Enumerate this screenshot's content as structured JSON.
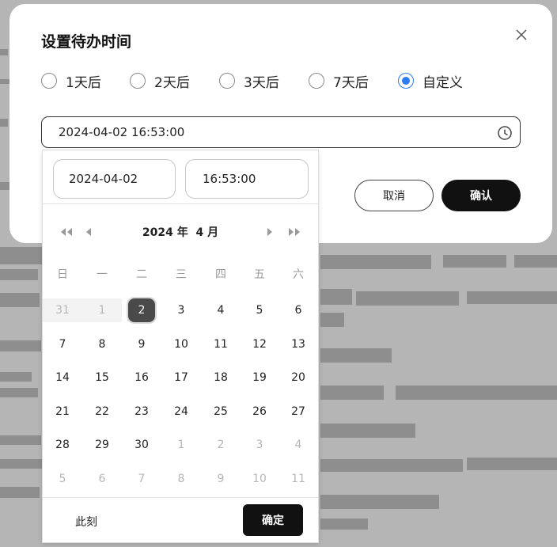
{
  "dialog": {
    "title": "设置待办时间",
    "options": [
      "1天后",
      "2天后",
      "3天后",
      "7天后",
      "自定义"
    ],
    "selected_option": "自定义",
    "datetime_value": "2024-04-02 16:53:00",
    "cancel_label": "取消",
    "confirm_label": "确认"
  },
  "picker": {
    "date_value": "2024-04-02",
    "time_value": "16:53:00",
    "year_label": "2024 年",
    "month_label": "4 月",
    "weekdays": [
      "日",
      "一",
      "二",
      "三",
      "四",
      "五",
      "六"
    ],
    "weeks": [
      [
        "31",
        "1",
        "2",
        "3",
        "4",
        "5",
        "6"
      ],
      [
        "7",
        "8",
        "9",
        "10",
        "11",
        "12",
        "13"
      ],
      [
        "14",
        "15",
        "16",
        "17",
        "18",
        "19",
        "20"
      ],
      [
        "21",
        "22",
        "23",
        "24",
        "25",
        "26",
        "27"
      ],
      [
        "28",
        "29",
        "30",
        "1",
        "2",
        "3",
        "4"
      ],
      [
        "5",
        "6",
        "7",
        "8",
        "9",
        "10",
        "11"
      ]
    ],
    "selected_day": "2",
    "now_label": "此刻",
    "ok_label": "确定"
  },
  "colors": {
    "accent": "#2f7bf2",
    "primary_button": "#111111",
    "selected_day": "#4a4a4a"
  }
}
